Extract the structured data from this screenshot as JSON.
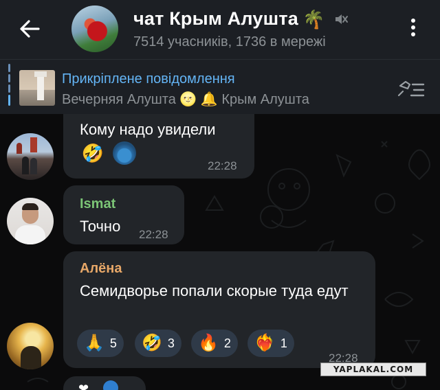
{
  "header": {
    "back_icon": "arrow-left-icon",
    "title": "чат Крым Алушта",
    "title_emoji": "🌴",
    "mute_icon": "muted-speaker-icon",
    "subtitle": "7514 учасників, 1736 в мережі",
    "more_icon": "more-vert-icon"
  },
  "pinned": {
    "title": "Прикріплене повідомлення",
    "text": "Вечерняя Алушта 🌝 🔔 Крым Алушта",
    "list_icon": "pinned-list-icon"
  },
  "messages": [
    {
      "text": "Кому надо увидели",
      "time": "22:28",
      "reactions": [
        {
          "emoji": "🤣"
        },
        {
          "emoji": "avatar"
        }
      ]
    },
    {
      "sender": "Ismat",
      "sender_color": "#7cc576",
      "text": "Точно",
      "time": "22:28"
    },
    {
      "sender": "Алёна",
      "sender_color": "#e8a868",
      "text": "Семидворье попали скорые туда едут",
      "time": "22:28",
      "reactions": [
        {
          "emoji": "🙏",
          "count": "5"
        },
        {
          "emoji": "🤣",
          "count": "3"
        },
        {
          "emoji": "🔥",
          "count": "2"
        },
        {
          "emoji": "❤️‍🔥",
          "count": "1"
        }
      ]
    }
  ],
  "watermark": "YAPLAKAL.COM",
  "colors": {
    "accent": "#64b5f6",
    "bubble": "#222529",
    "header": "#1c1f24",
    "reaction_bg": "#2f3a48"
  }
}
